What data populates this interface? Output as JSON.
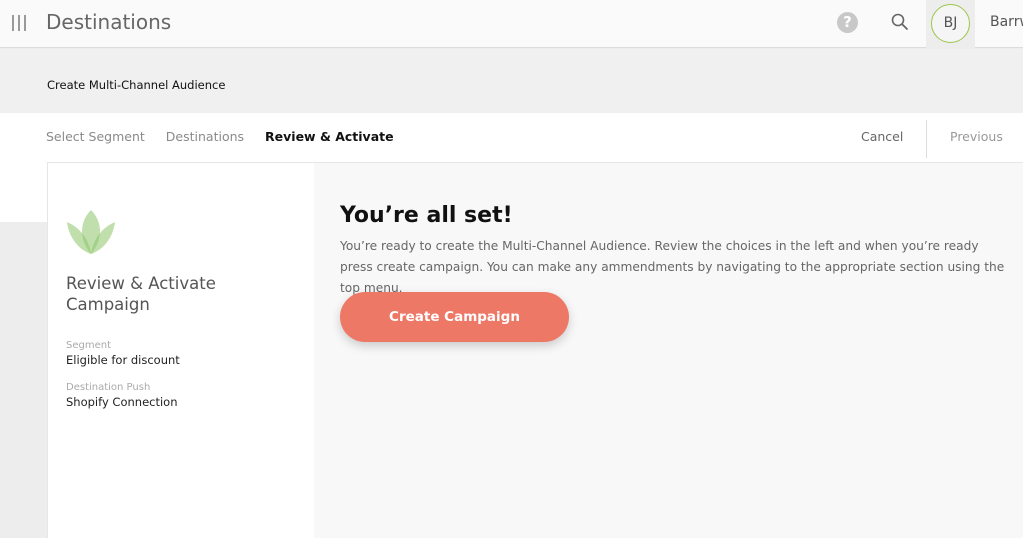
{
  "topbar": {
    "title": "Destinations",
    "help_glyph": "?",
    "avatar_initials": "BJ",
    "user_name": "Barrw",
    "icons": [
      "menu-icon",
      "help-icon",
      "search-icon",
      "avatar"
    ]
  },
  "page": {
    "title": "Create Multi-Channel Audience"
  },
  "wizard": {
    "steps": [
      {
        "label": "Select Segment",
        "active": false
      },
      {
        "label": "Destinations",
        "active": false
      },
      {
        "label": "Review & Activate",
        "active": true
      }
    ],
    "cancel_label": "Cancel",
    "previous_label": "Previous"
  },
  "summary": {
    "title": "Review & Activate Campaign",
    "segment_label": "Segment",
    "segment_value": "Eligible for discount",
    "destination_label": "Destination Push",
    "destination_value": "Shopify Connection"
  },
  "main": {
    "headline": "You’re all set!",
    "description": "You’re ready to create the Multi-Channel Audience. Review the choices in the left and when you’re ready press create campaign. You can make any ammendments by navigating to the appropriate section using the top menu.",
    "cta_label": "Create Campaign"
  },
  "colors": {
    "accent": "#ee7866",
    "avatar_ring": "#9cc64a",
    "leaf": "#8cc56a"
  }
}
